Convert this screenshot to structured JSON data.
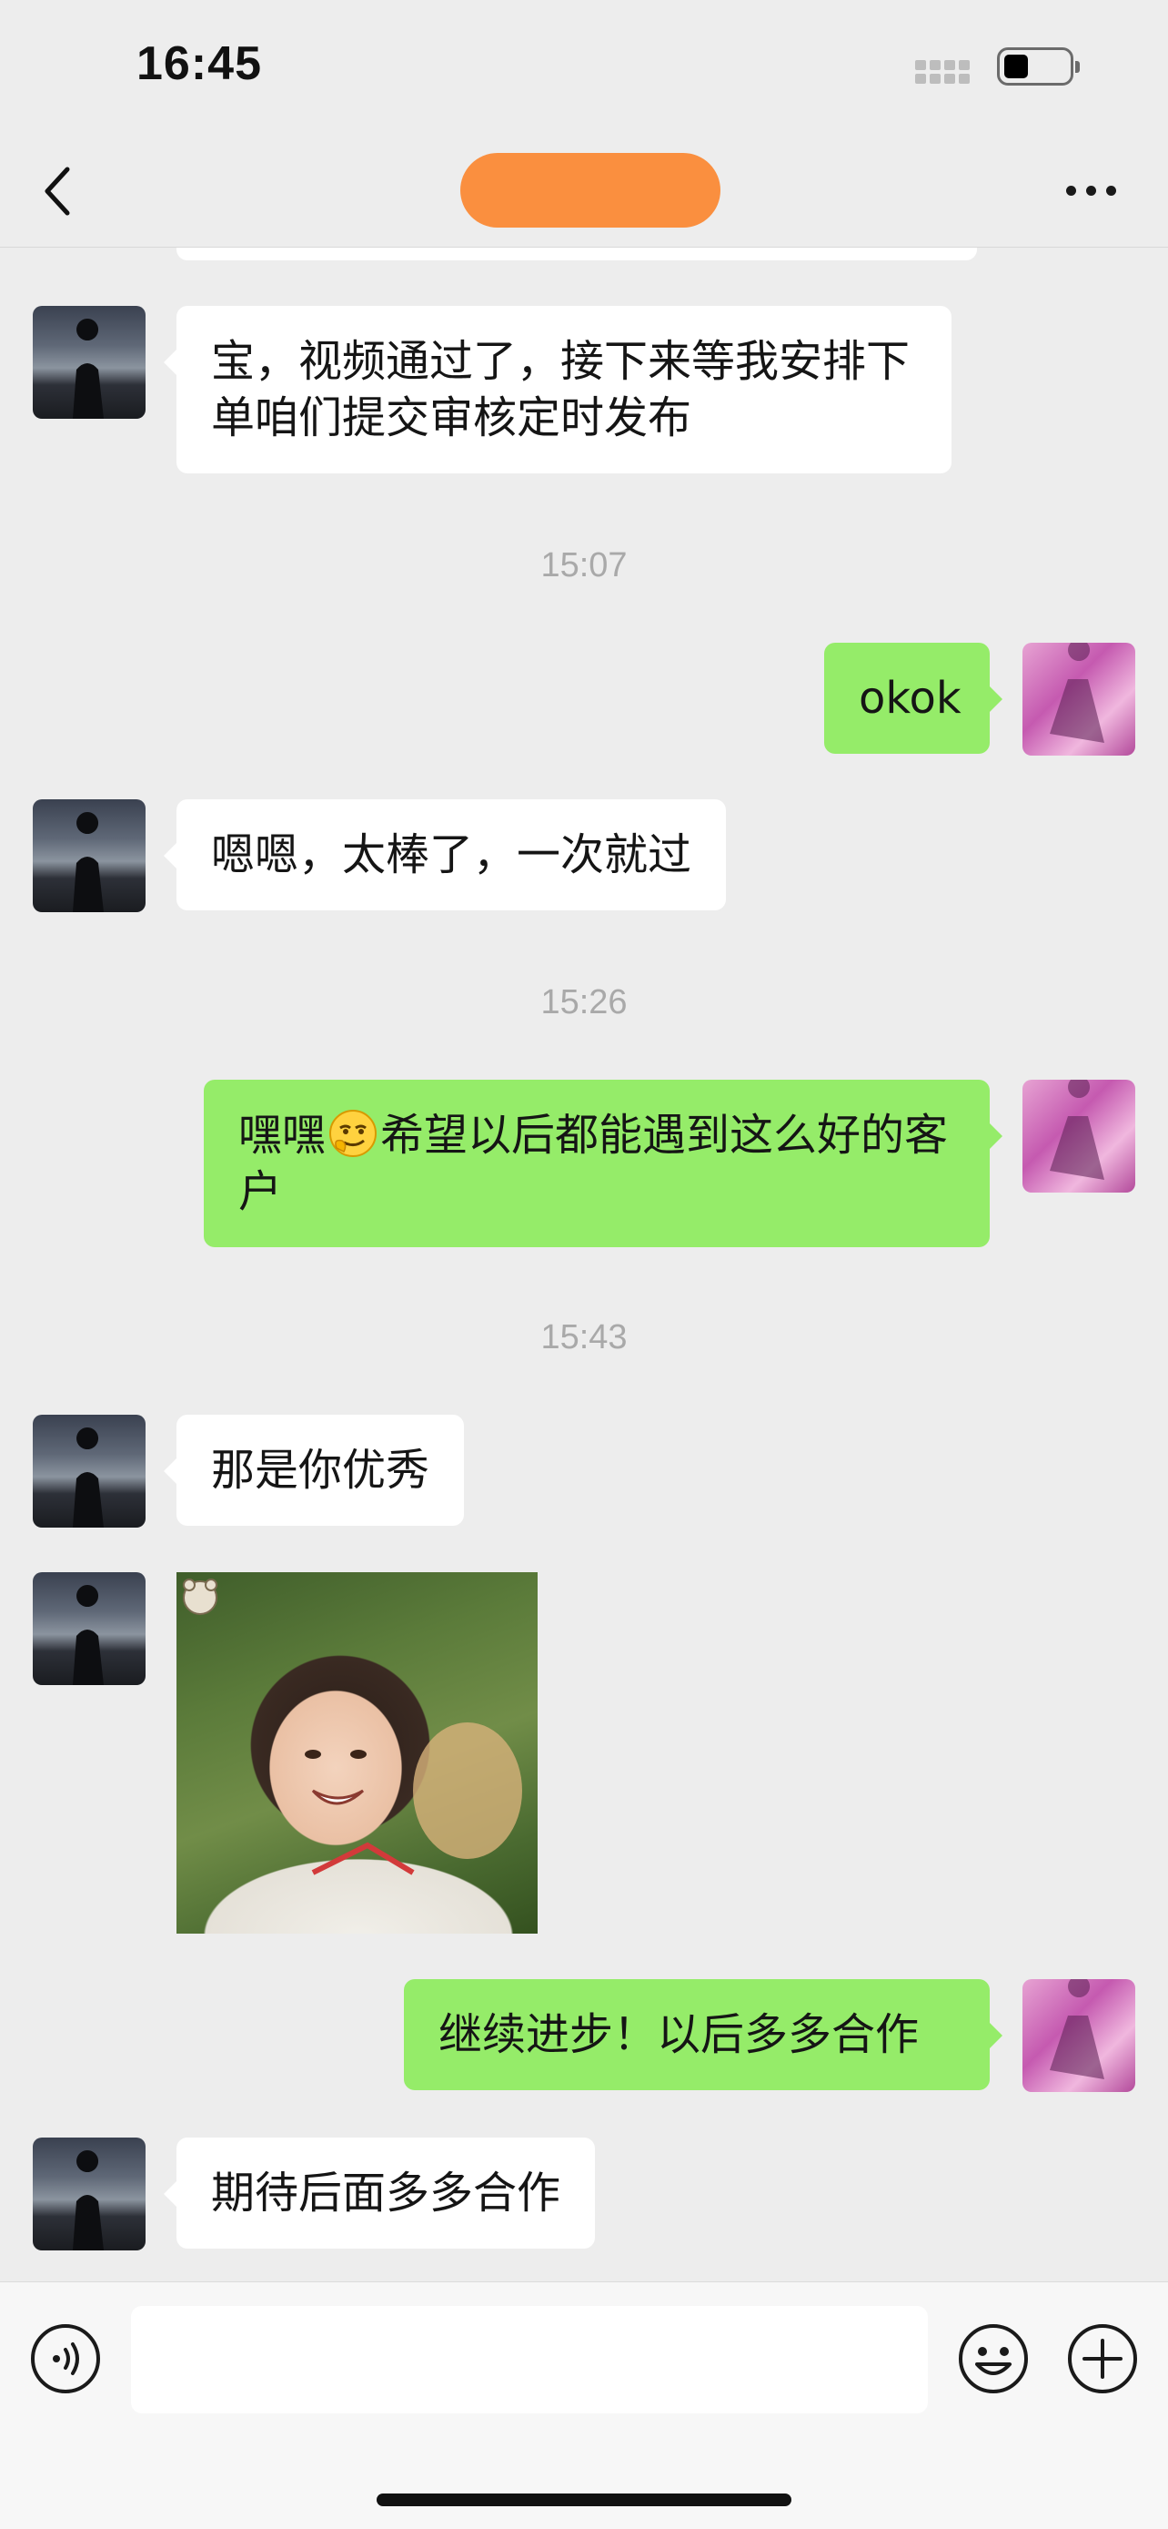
{
  "status_bar": {
    "time": "16:45"
  },
  "nav": {
    "back_icon": "chevron-left-icon",
    "more_icon": "ellipsis-icon",
    "title_redaction_color": "#FA8F3F"
  },
  "messages": [
    {
      "side": "in",
      "type": "text",
      "text": "宝，视频通过了，接下来等我安排下单咱们提交审核定时发布"
    },
    {
      "type": "time",
      "text": "15:07"
    },
    {
      "side": "out",
      "type": "text",
      "text": "okok"
    },
    {
      "side": "in",
      "type": "text",
      "text": "嗯嗯，太棒了，一次就过"
    },
    {
      "type": "time",
      "text": "15:26"
    },
    {
      "side": "out",
      "type": "text",
      "text_before": "嘿嘿",
      "emoji": "smirk-emoji-icon",
      "text_after": "希望以后都能遇到这么好的客户"
    },
    {
      "type": "time",
      "text": "15:43"
    },
    {
      "side": "in",
      "type": "text",
      "text": "那是你优秀"
    },
    {
      "side": "in",
      "type": "image",
      "subject": "smiling-child-photo"
    },
    {
      "side": "out",
      "type": "text",
      "text": "继续进步！以后多多合作"
    },
    {
      "side": "in",
      "type": "text",
      "text": "期待后面多多合作"
    }
  ],
  "input_bar": {
    "voice_icon": "voice-icon",
    "emoji_icon": "emoji-icon",
    "plus_icon": "plus-icon",
    "input_value": "",
    "input_placeholder": ""
  },
  "colors": {
    "background": "#EDEDED",
    "bubble_in": "#FFFFFF",
    "bubble_out": "#95EC69",
    "timestamp": "#A9A9A9"
  }
}
